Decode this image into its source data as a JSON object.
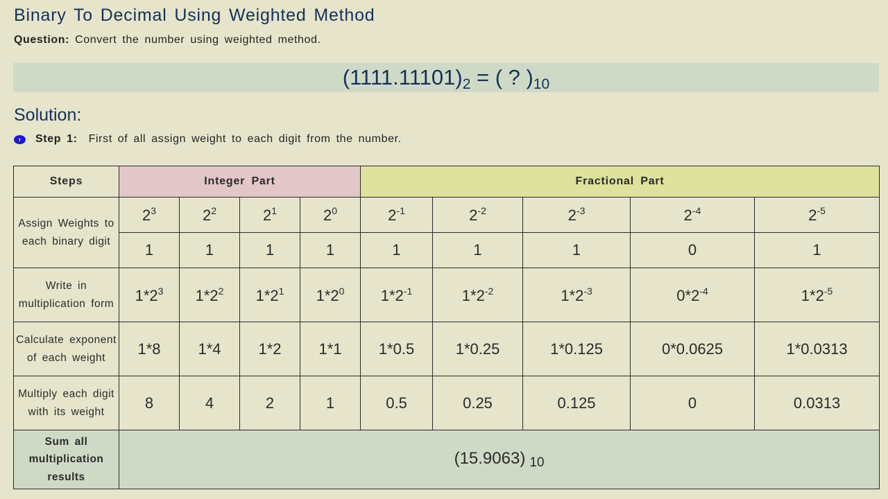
{
  "title": "Binary To Decimal Using Weighted Method",
  "question": {
    "label": "Question:",
    "text": "Convert the number using weighted method."
  },
  "equation": {
    "number": "(1111.11101)",
    "base_from": "2",
    "equals": " = ( ? )",
    "base_to": "10"
  },
  "solution_heading": "Solution:",
  "step1": {
    "bullet_icon": "chevron-right-circle",
    "label": "Step 1:",
    "text": "First of all assign weight to each digit from the number."
  },
  "table": {
    "headers": {
      "steps": "Steps",
      "integer": "Integer Part",
      "fractional": "Fractional Part"
    },
    "row_labels": {
      "assign": "Assign Weights to each binary digit",
      "multiplication": "Write in multiplication form",
      "exponent": "Calculate exponent of each weight",
      "multiply": "Multiply each digit with its weight",
      "sum": "Sum all multiplication results"
    },
    "columns": [
      {
        "part": "integer",
        "exp": "3",
        "digit": "1",
        "mult": "1*2",
        "calc": "1*8",
        "product": "8"
      },
      {
        "part": "integer",
        "exp": "2",
        "digit": "1",
        "mult": "1*2",
        "calc": "1*4",
        "product": "4"
      },
      {
        "part": "integer",
        "exp": "1",
        "digit": "1",
        "mult": "1*2",
        "calc": "1*2",
        "product": "2"
      },
      {
        "part": "integer",
        "exp": "0",
        "digit": "1",
        "mult": "1*2",
        "calc": "1*1",
        "product": "1"
      },
      {
        "part": "fractional",
        "exp": "-1",
        "digit": "1",
        "mult": "1*2",
        "calc": "1*0.5",
        "product": "0.5"
      },
      {
        "part": "fractional",
        "exp": "-2",
        "digit": "1",
        "mult": "1*2",
        "calc": "1*0.25",
        "product": "0.25"
      },
      {
        "part": "fractional",
        "exp": "-3",
        "digit": "1",
        "mult": "1*2",
        "calc": "1*0.125",
        "product": "0.125"
      },
      {
        "part": "fractional",
        "exp": "-4",
        "digit": "0",
        "mult": "0*2",
        "calc": "0*0.0625",
        "product": "0"
      },
      {
        "part": "fractional",
        "exp": "-5",
        "digit": "1",
        "mult": "1*2",
        "calc": "1*0.0313",
        "product": "0.0313"
      }
    ],
    "base": "2",
    "sum": {
      "value": "(15.9063)",
      "base": "10"
    }
  }
}
